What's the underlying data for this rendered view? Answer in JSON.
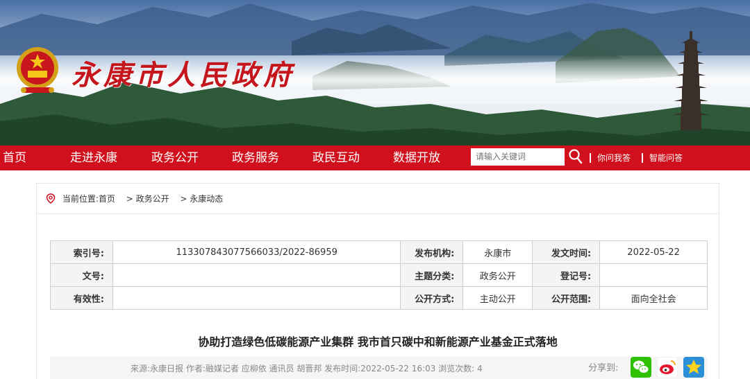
{
  "site": {
    "title": "永康市人民政府"
  },
  "nav": {
    "items": [
      "首页",
      "走进永康",
      "政务公开",
      "政务服务",
      "政民互动",
      "数据开放"
    ],
    "search_placeholder": "请输入关键词",
    "links": [
      "你问我答",
      "智能问答"
    ]
  },
  "breadcrumb": {
    "prefix": "当前位置:首页",
    "items": [
      "> 政务公开",
      "> 永康动态"
    ]
  },
  "meta": {
    "index_label": "索引号:",
    "index_value": "113307843077566033/2022-86959",
    "publisher_label": "发布机构:",
    "publisher_value": "永康市",
    "issue_date_label": "发文时间:",
    "issue_date_value": "2022-05-22",
    "doc_no_label": "文号:",
    "doc_no_value": "",
    "topic_label": "主题分类:",
    "topic_value": "政务公开",
    "register_label": "登记号:",
    "register_value": "",
    "validity_label": "有效性:",
    "validity_value": "",
    "open_mode_label": "公开方式:",
    "open_mode_value": "主动公开",
    "open_scope_label": "公开范围:",
    "open_scope_value": "面向全社会"
  },
  "article": {
    "title": "协助打造绿色低碳能源产业集群 我市首只碳中和新能源产业基金正式落地",
    "info": "来源:永康日报   作者:融媒记者 应柳依 通讯员 胡晋邦   发布时间:2022-05-22 16:03   浏览次数: 4",
    "share_label": "分享到:"
  },
  "colors": {
    "brand_red": "#d0101c",
    "title_red": "#c4161c"
  }
}
